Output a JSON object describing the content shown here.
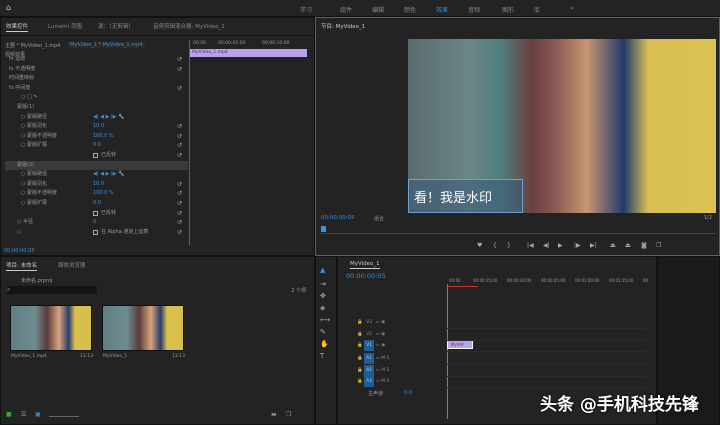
{
  "topbar": {
    "home_icon": "home-icon",
    "workspaces": [
      "学习",
      "组件",
      "编辑",
      "颜色",
      "效果",
      "音频",
      "图形",
      "库"
    ],
    "active": "效果",
    "more": "»"
  },
  "effect_controls": {
    "tabs": [
      "效果控件",
      "Lumetri 范围",
      "源：（无剪辑）",
      "音频剪辑混合器: MyVideo_1"
    ],
    "source_label": "主要 * MyVideo_1.mp4",
    "clip_select": "MyVideo_1 * MyVideo_1.mp4",
    "mini_timeline": {
      "ticks": [
        "00:00",
        "00:00:05:00",
        "00:00:10:00"
      ],
      "clip": "MyVideo_1.mp4"
    },
    "section": "视频效果",
    "rows": [
      {
        "label": "fx  运动",
        "value": "",
        "reset": true,
        "indent": 1
      },
      {
        "label": "fx  不透明度",
        "value": "",
        "reset": true,
        "indent": 1
      },
      {
        "label": "  时间重映射",
        "value": "",
        "reset": false,
        "indent": 1
      },
      {
        "label": "fx  中间值",
        "value": "",
        "reset": true,
        "indent": 1
      },
      {
        "label": "○  □  ✎",
        "value": "",
        "reset": false,
        "indent": 4
      },
      {
        "label": "蒙版(1)",
        "value": "",
        "reset": false,
        "indent": 3
      },
      {
        "label": "○ 蒙版路径",
        "value": "◀|  ◀  ▶  |▶  🔧",
        "reset": false,
        "indent": 4
      },
      {
        "label": "○ 蒙版羽化",
        "value": "10.0",
        "reset": true,
        "indent": 4
      },
      {
        "label": "○ 蒙版不透明度",
        "value": "100.0 %",
        "reset": true,
        "indent": 4
      },
      {
        "label": "○ 蒙版扩展",
        "value": "0.0",
        "reset": true,
        "indent": 4
      },
      {
        "label": "",
        "value": "已反转",
        "check": true,
        "reset": true,
        "indent": 4
      },
      {
        "label": "蒙版(2)",
        "value": "",
        "reset": false,
        "indent": 3,
        "highlight": true
      },
      {
        "label": "○ 蒙版路径",
        "value": "◀|  ◀  ▶  |▶  🔧",
        "reset": false,
        "indent": 4
      },
      {
        "label": "○ 蒙版羽化",
        "value": "10.0",
        "reset": true,
        "indent": 4
      },
      {
        "label": "○ 蒙版不透明度",
        "value": "100.0 %",
        "reset": true,
        "indent": 4
      },
      {
        "label": "○ 蒙版扩展",
        "value": "0.0",
        "reset": true,
        "indent": 4
      },
      {
        "label": "",
        "value": "已反转",
        "check": true,
        "reset": true,
        "indent": 4
      },
      {
        "label": "○ 半径",
        "value": "0",
        "reset": true,
        "indent": 3
      },
      {
        "label": "○",
        "value": "在 Alpha 通道上运算",
        "check": true,
        "reset": true,
        "indent": 3
      }
    ],
    "timecode": "00:00:00:05"
  },
  "program": {
    "title": "节目: MyVideo_1",
    "watermark": "看！我是水印",
    "timecode": "00:00:00:05",
    "fit": "适合",
    "resolution": "1/2"
  },
  "project": {
    "tabs": [
      "项目: 未命名",
      "媒体浏览器"
    ],
    "file": "未命名.prproj",
    "count": "2 个项",
    "items": [
      {
        "name": "MyVideo_1.mp4",
        "duration": "13:13"
      },
      {
        "name": "MyVideo_1",
        "duration": "13:13"
      }
    ]
  },
  "timeline": {
    "tab": "MyVideo_1",
    "timecode": "00:00:00:05",
    "ticks": [
      "00:00",
      "00:00:15:00",
      "00:00:30:00",
      "00:00:45:00",
      "00:01:00:00",
      "00:01:15:00",
      "00"
    ],
    "tracks": [
      {
        "name": "V3",
        "target": false
      },
      {
        "name": "V2",
        "target": false
      },
      {
        "name": "V1",
        "target": true
      },
      {
        "name": "A1",
        "target": true
      },
      {
        "name": "A2",
        "target": true
      },
      {
        "name": "A3",
        "target": true
      }
    ],
    "master": "主声道",
    "master_value": "0.0",
    "clip": "MyVid"
  },
  "overlay": {
    "watermark": "头条 @手机科技先锋"
  },
  "colors": {
    "accent": "#2d8ceb",
    "clip": "#b9a2ea",
    "bg": "#232323"
  }
}
